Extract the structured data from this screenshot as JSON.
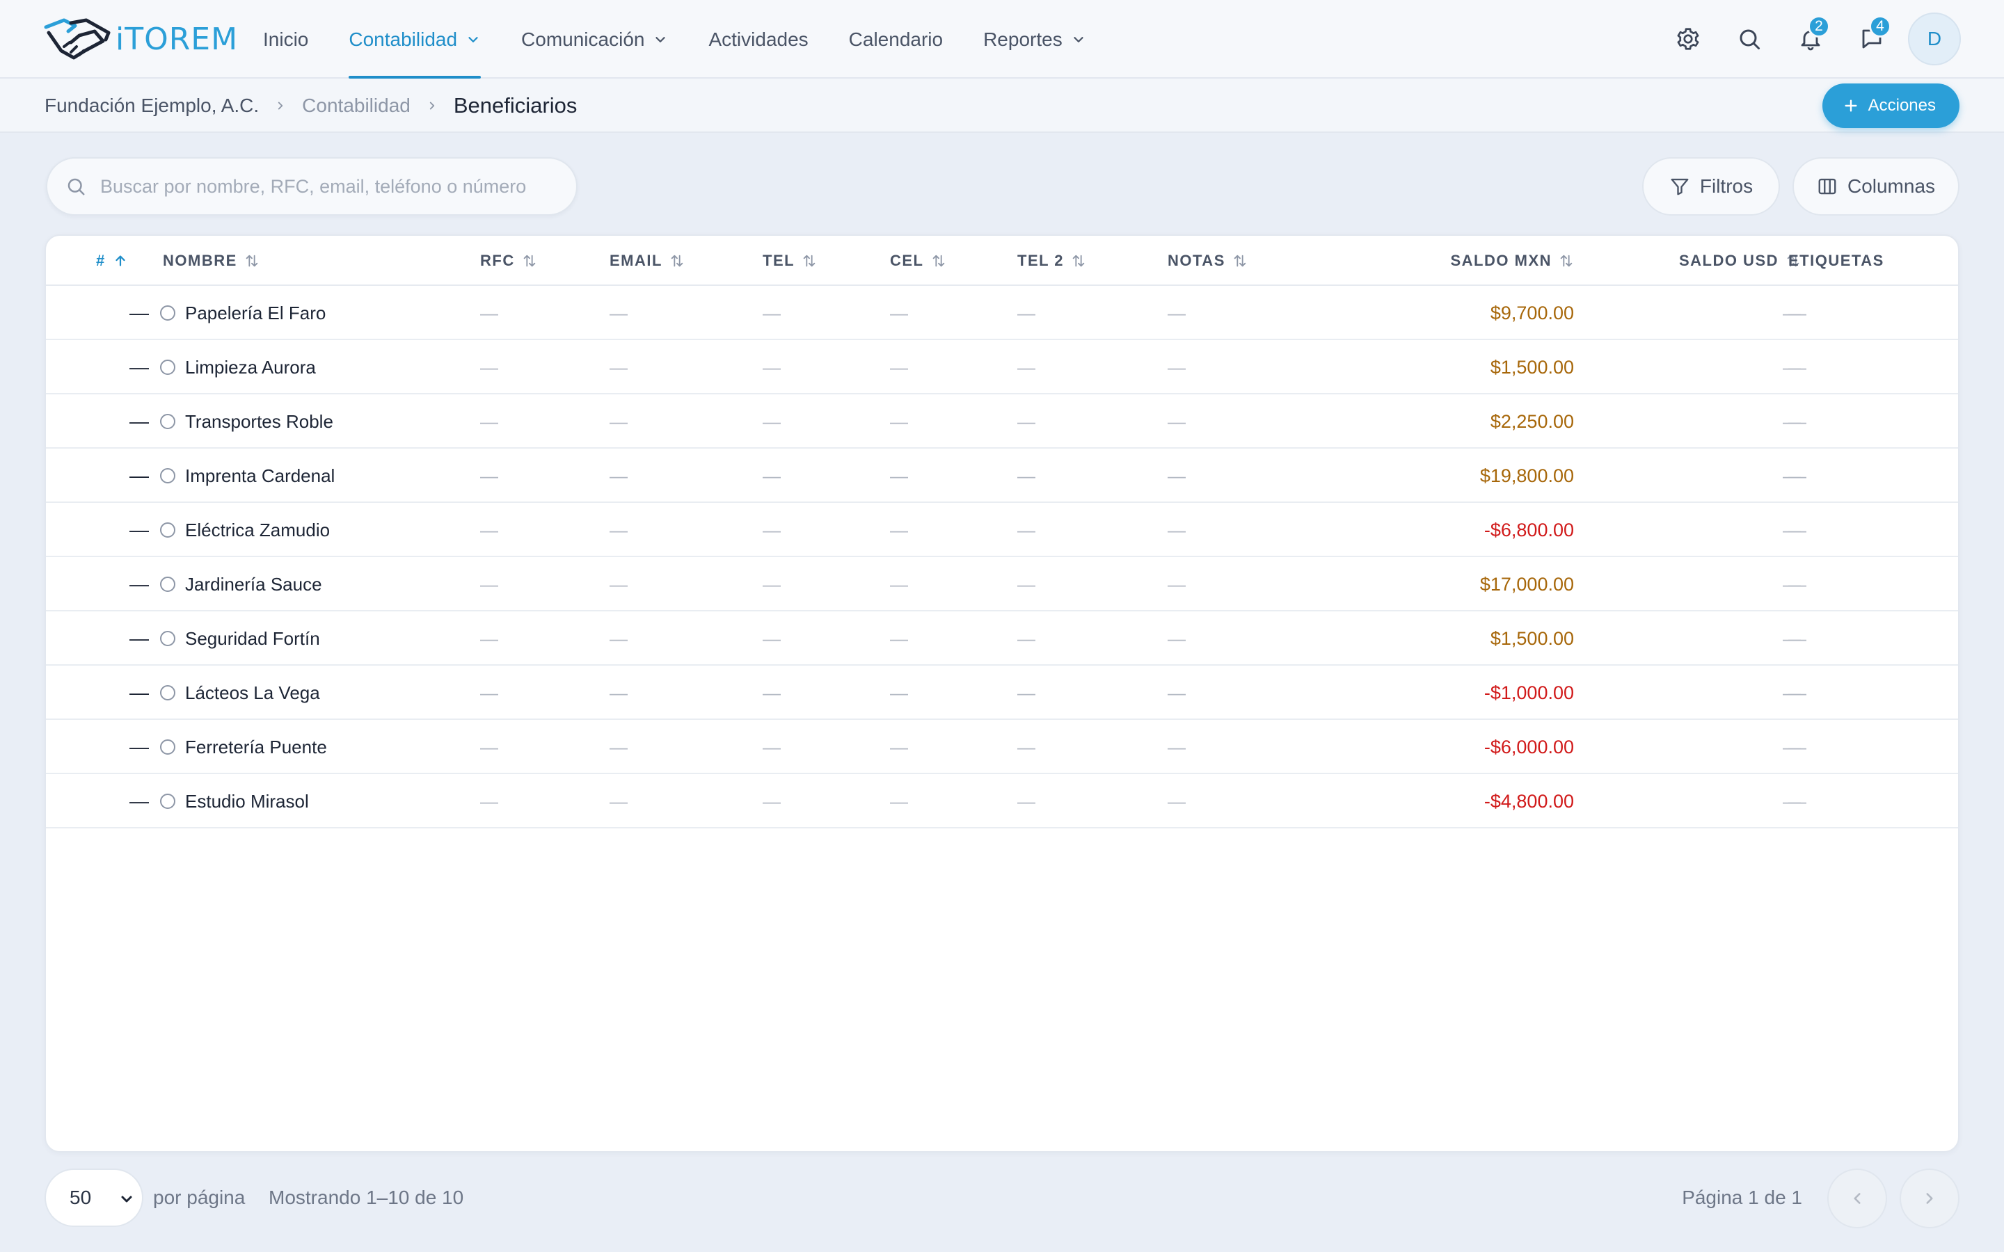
{
  "app": {
    "logo_text": "iTOREM"
  },
  "nav": {
    "items": [
      {
        "label": "Inicio",
        "active": false,
        "dropdown": false
      },
      {
        "label": "Contabilidad",
        "active": true,
        "dropdown": true
      },
      {
        "label": "Comunicación",
        "active": false,
        "dropdown": true
      },
      {
        "label": "Actividades",
        "active": false,
        "dropdown": false
      },
      {
        "label": "Calendario",
        "active": false,
        "dropdown": false
      },
      {
        "label": "Reportes",
        "active": false,
        "dropdown": true
      }
    ],
    "notifications_count": "2",
    "messages_count": "4",
    "avatar_initial": "D"
  },
  "breadcrumb": {
    "org": "Fundación Ejemplo, A.C.",
    "section": "Contabilidad",
    "current": "Beneficiarios"
  },
  "actions_label": "Acciones",
  "search": {
    "placeholder": "Buscar por nombre, RFC, email, teléfono o número",
    "value": ""
  },
  "toolbar": {
    "filters_label": "Filtros",
    "columns_label": "Columnas"
  },
  "table": {
    "columns": {
      "num": "#",
      "nombre": "NOMBRE",
      "rfc": "RFC",
      "email": "EMAIL",
      "tel": "TEL",
      "cel": "CEL",
      "tel2": "TEL 2",
      "notas": "NOTAS",
      "saldo_mxn": "SALDO MXN",
      "saldo_usd": "SALDO USD",
      "etiquetas": "ETIQUETAS"
    },
    "empty": "—",
    "rows": [
      {
        "num": "—",
        "nombre": "Papelería El Faro",
        "rfc": "—",
        "email": "—",
        "tel": "—",
        "cel": "—",
        "tel2": "—",
        "notas": "—",
        "saldo_mxn": "$9,700.00",
        "saldo_usd": "—",
        "etiquetas": "—"
      },
      {
        "num": "—",
        "nombre": "Limpieza Aurora",
        "rfc": "—",
        "email": "—",
        "tel": "—",
        "cel": "—",
        "tel2": "—",
        "notas": "—",
        "saldo_mxn": "$1,500.00",
        "saldo_usd": "—",
        "etiquetas": "—"
      },
      {
        "num": "—",
        "nombre": "Transportes Roble",
        "rfc": "—",
        "email": "—",
        "tel": "—",
        "cel": "—",
        "tel2": "—",
        "notas": "—",
        "saldo_mxn": "$2,250.00",
        "saldo_usd": "—",
        "etiquetas": "—"
      },
      {
        "num": "—",
        "nombre": "Imprenta Cardenal",
        "rfc": "—",
        "email": "—",
        "tel": "—",
        "cel": "—",
        "tel2": "—",
        "notas": "—",
        "saldo_mxn": "$19,800.00",
        "saldo_usd": "—",
        "etiquetas": "—"
      },
      {
        "num": "—",
        "nombre": "Eléctrica Zamudio",
        "rfc": "—",
        "email": "—",
        "tel": "—",
        "cel": "—",
        "tel2": "—",
        "notas": "—",
        "saldo_mxn": "-$6,800.00",
        "saldo_usd": "—",
        "etiquetas": "—"
      },
      {
        "num": "—",
        "nombre": "Jardinería Sauce",
        "rfc": "—",
        "email": "—",
        "tel": "—",
        "cel": "—",
        "tel2": "—",
        "notas": "—",
        "saldo_mxn": "$17,000.00",
        "saldo_usd": "—",
        "etiquetas": "—"
      },
      {
        "num": "—",
        "nombre": "Seguridad Fortín",
        "rfc": "—",
        "email": "—",
        "tel": "—",
        "cel": "—",
        "tel2": "—",
        "notas": "—",
        "saldo_mxn": "$1,500.00",
        "saldo_usd": "—",
        "etiquetas": "—"
      },
      {
        "num": "—",
        "nombre": "Lácteos La Vega",
        "rfc": "—",
        "email": "—",
        "tel": "—",
        "cel": "—",
        "tel2": "—",
        "notas": "—",
        "saldo_mxn": "-$1,000.00",
        "saldo_usd": "—",
        "etiquetas": "—"
      },
      {
        "num": "—",
        "nombre": "Ferretería Puente",
        "rfc": "—",
        "email": "—",
        "tel": "—",
        "cel": "—",
        "tel2": "—",
        "notas": "—",
        "saldo_mxn": "-$6,000.00",
        "saldo_usd": "—",
        "etiquetas": "—"
      },
      {
        "num": "—",
        "nombre": "Estudio Mirasol",
        "rfc": "—",
        "email": "—",
        "tel": "—",
        "cel": "—",
        "tel2": "—",
        "notas": "—",
        "saldo_mxn": "-$4,800.00",
        "saldo_usd": "—",
        "etiquetas": "—"
      }
    ]
  },
  "footer": {
    "per_page_value": "50",
    "per_page_label": "por página",
    "showing": "Mostrando 1–10 de 10",
    "page_info": "Página 1 de 1"
  },
  "colors": {
    "accent": "#2b9fd8",
    "positive_balance": "#a7670a",
    "negative_balance": "#d11a1a"
  },
  "icons": {
    "logo": "handshake-icon",
    "settings": "gear-icon",
    "search": "search-icon",
    "notifications": "bell-icon",
    "messages": "chat-icon",
    "filters": "funnel-icon",
    "columns": "columns-icon",
    "actions": "plus-icon"
  }
}
